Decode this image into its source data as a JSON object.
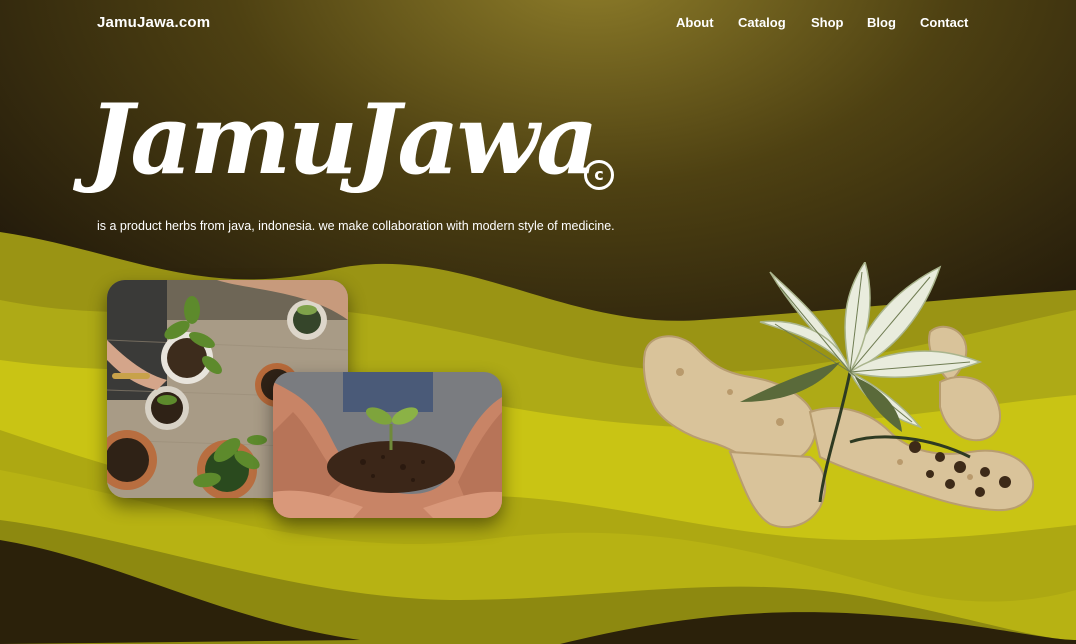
{
  "nav": {
    "brand": "JamuJawa.com",
    "items": [
      "About",
      "Catalog",
      "Shop",
      "Blog",
      "Contact"
    ]
  },
  "hero": {
    "title": "JamuJawa",
    "mark": "c",
    "tagline": "is a product herbs from java, indonesia. we make collaboration with modern style of medicine."
  },
  "colors": {
    "dark_brown": "#1c1408",
    "olive": "#8a7a24",
    "lime": "#c9c414",
    "text": "#ffffff"
  }
}
